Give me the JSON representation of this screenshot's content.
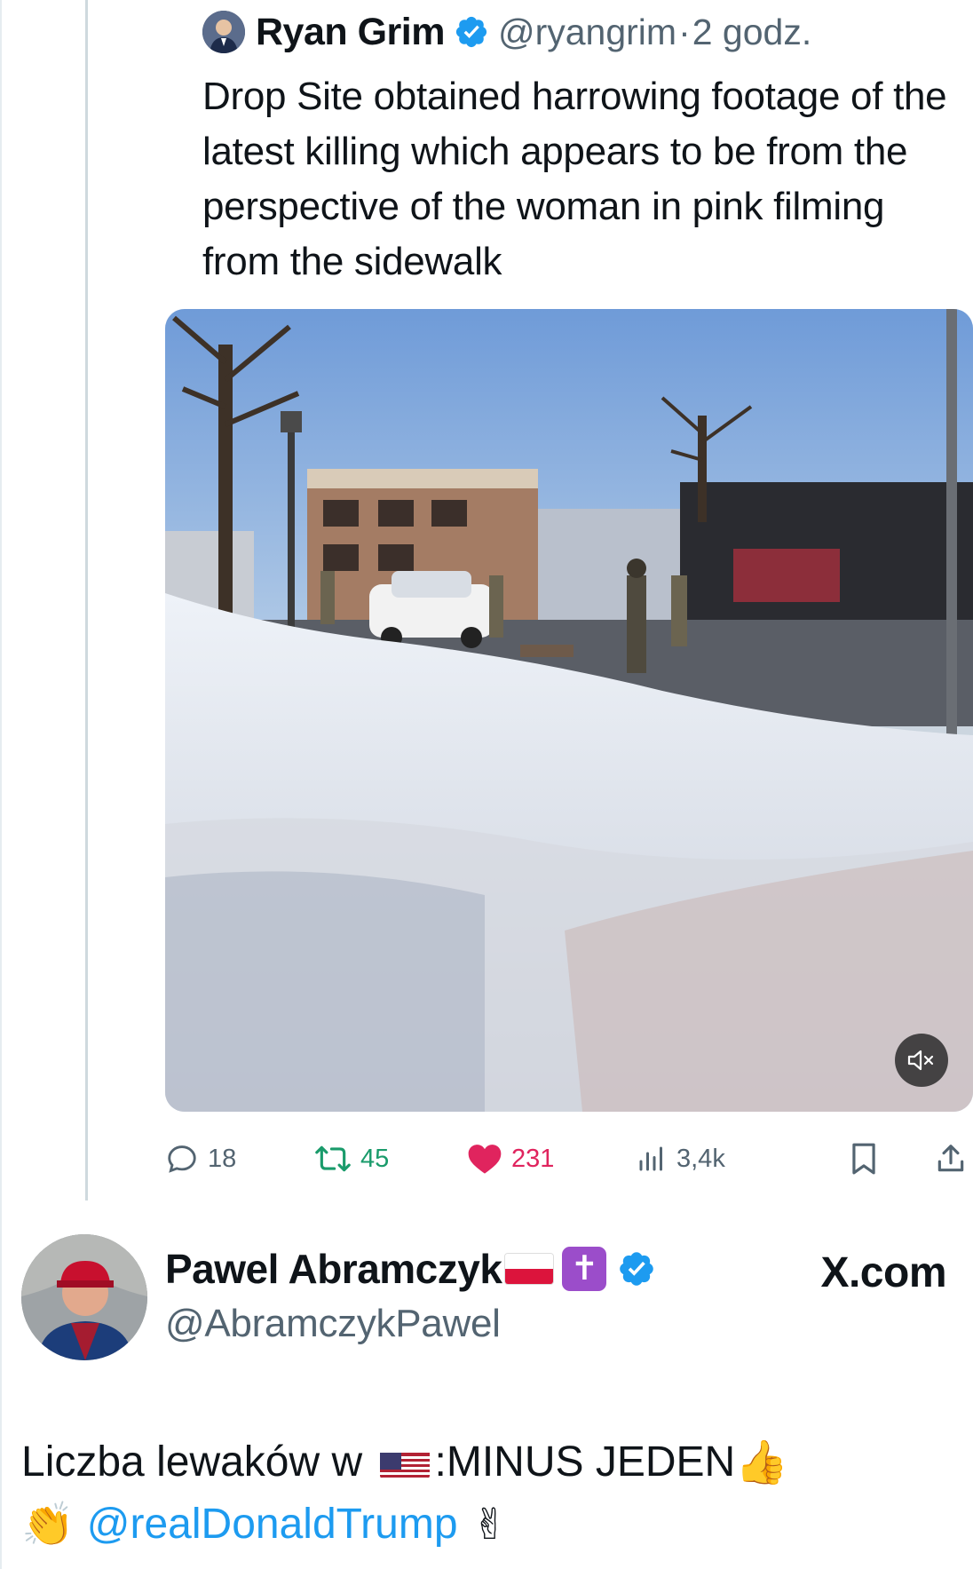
{
  "quoted_tweet": {
    "author_name": "Ryan Grim",
    "author_handle": "@ryangrim",
    "separator": "·",
    "time": "2 godz.",
    "text": "Drop Site obtained harrowing footage of the latest killing which appears to be from the perspective of the woman in pink filming from the sidewalk",
    "media": {
      "kind": "video",
      "muted": true,
      "mute_icon": "speaker-muted-icon"
    },
    "actions": {
      "replies": "18",
      "reposts": "45",
      "likes": "231",
      "views": "3,4k"
    }
  },
  "tweet": {
    "author_name": "Pawel Abramczyk",
    "author_handle": "@AbramczykPawel",
    "source_label": "X.com",
    "badges": [
      "poland-flag",
      "latin-cross",
      "verified"
    ],
    "cross_glyph": "✝",
    "body_line1_prefix": "Liczba lewaków w ",
    "body_line1_suffix": ":MINUS JEDEN",
    "thumbs_up": "👍",
    "clap": "👏",
    "mention": "@realDonaldTrump",
    "victory": "✌"
  },
  "colors": {
    "accent": "#1d9bf0",
    "verified": "#1d9bf0",
    "repost": "#1a9b6b",
    "like": "#e0245e",
    "muted_text": "#536471",
    "text": "#0f1419"
  }
}
